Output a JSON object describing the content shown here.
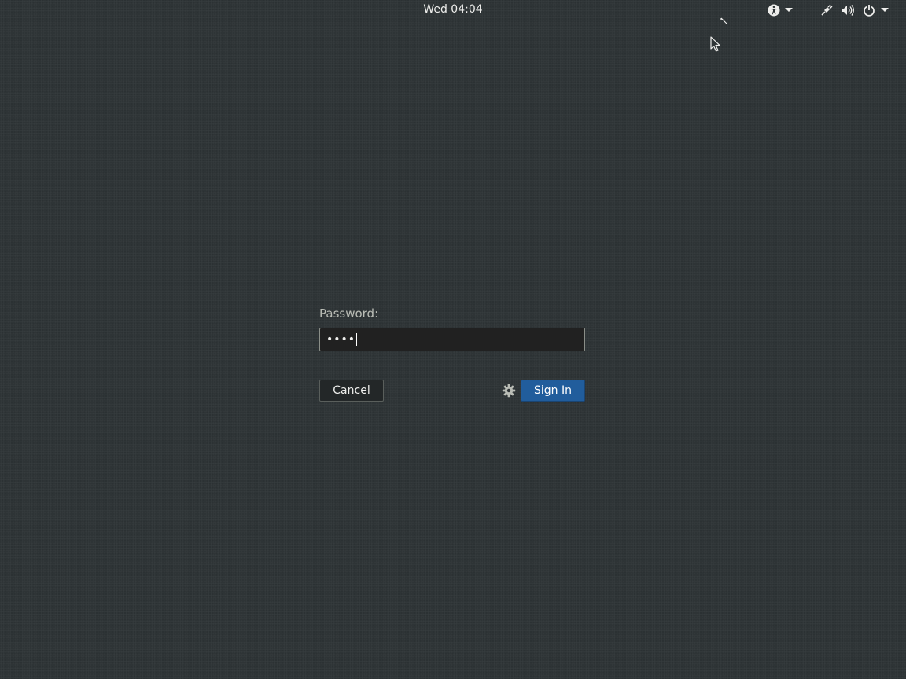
{
  "topbar": {
    "clock": "Wed 04:04",
    "icons": [
      "accessibility-icon",
      "dropdown-arrow-icon",
      "wired-network-icon",
      "volume-icon",
      "power-icon",
      "dropdown-arrow-icon"
    ]
  },
  "login": {
    "prompt_label": "Password:",
    "password_mask": "••••",
    "cancel_label": "Cancel",
    "signin_label": "Sign In",
    "session_icon": "gear-icon"
  },
  "colors": {
    "background": "#2e3436",
    "signin_button": "#215d9c",
    "entry_background": "#212121",
    "label": "#babdb6"
  }
}
